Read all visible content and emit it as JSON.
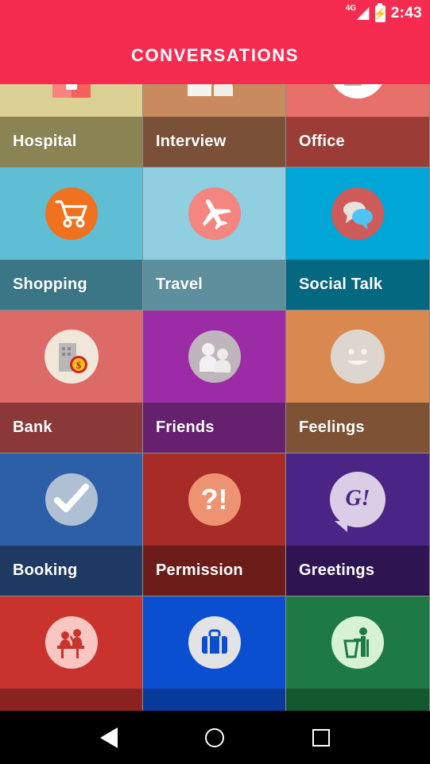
{
  "status_bar": {
    "network_label": "4G",
    "signal_icon": "signal-bars-icon",
    "battery_icon": "battery-charging-icon",
    "time": "2:43"
  },
  "app_bar": {
    "title": "CONVERSATIONS",
    "background_color": "#F52B50"
  },
  "grid": {
    "columns": 3,
    "tiles": [
      {
        "label": "Hospital",
        "icon": "hospital-house-icon",
        "top_color": "#DBD195",
        "label_color": "#8A8455"
      },
      {
        "label": "Interview",
        "icon": "interview-people-icon",
        "top_color": "#C98B5E",
        "label_color": "#7A5138"
      },
      {
        "label": "Office",
        "icon": "office-briefcase-icon",
        "top_color": "#E8706A",
        "label_color": "#9C3C37"
      },
      {
        "label": "Shopping",
        "icon": "shopping-cart-icon",
        "top_color": "#5FBED4",
        "label_color": "#3A7685"
      },
      {
        "label": "Travel",
        "icon": "airplane-icon",
        "top_color": "#8FCFE0",
        "label_color": "#5D8F9D"
      },
      {
        "label": "Social Talk",
        "icon": "speech-bubbles-icon",
        "top_color": "#00A6D6",
        "label_color": "#046880"
      },
      {
        "label": "Bank",
        "icon": "bank-coin-icon",
        "top_color": "#DC6A67",
        "label_color": "#8A3838"
      },
      {
        "label": "Friends",
        "icon": "friends-people-icon",
        "top_color": "#9B2CA5",
        "label_color": "#65206E"
      },
      {
        "label": "Feelings",
        "icon": "smiley-face-icon",
        "top_color": "#D9884F",
        "label_color": "#7E5335"
      },
      {
        "label": "Booking",
        "icon": "checkmark-icon",
        "top_color": "#2C5FA8",
        "label_color": "#1E3A63"
      },
      {
        "label": "Permission",
        "icon": "question-exclaim-icon",
        "top_color": "#A72B27",
        "label_color": "#6C1D1A"
      },
      {
        "label": "Greetings",
        "icon": "greeting-bubble-g-icon",
        "top_color": "#4B2586",
        "label_color": "#2E1551"
      },
      {
        "label": "",
        "icon": "reception-desk-icon",
        "top_color": "#C9332E",
        "label_color": "#8A231F"
      },
      {
        "label": "",
        "icon": "suitcase-icon",
        "top_color": "#0B4FD1",
        "label_color": "#083A99"
      },
      {
        "label": "",
        "icon": "trash-person-icon",
        "top_color": "#1E7A44",
        "label_color": "#145830"
      }
    ]
  },
  "nav_bar": {
    "back_label": "Back",
    "home_label": "Home",
    "recents_label": "Recents"
  }
}
